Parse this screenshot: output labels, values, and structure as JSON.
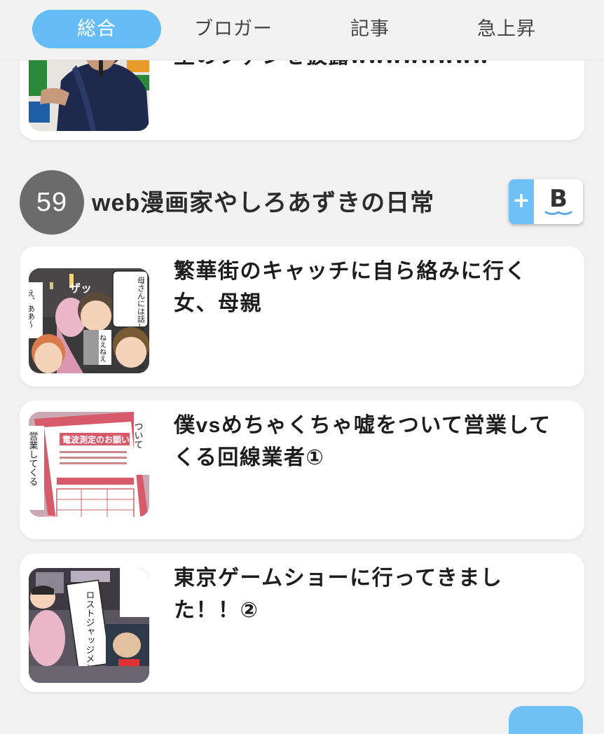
{
  "tabs": [
    {
      "label": "総合",
      "active": true
    },
    {
      "label": "ブロガー",
      "active": false
    },
    {
      "label": "記事",
      "active": false
    },
    {
      "label": "急上昇",
      "active": false
    }
  ],
  "top_card": {
    "title": "里のファンを披露wwwwwwww",
    "thumb_icon": "baseball-player-photo"
  },
  "blog": {
    "rank": "59",
    "name": "web漫画家やしろあずきの日常",
    "hatena_plus": "+",
    "hatena_b": "B",
    "accent_color": "#66bdf6"
  },
  "articles": [
    {
      "title": "繁華街のキャッチに自ら絡みに行く女、母親",
      "thumb_icon": "manga-thumbnail"
    },
    {
      "title": "僕vsめちゃくちゃ嘘をついて営業してくる回線業者①",
      "thumb_icon": "manga-thumbnail"
    },
    {
      "title": "東京ゲームショーに行ってきました！！②",
      "thumb_icon": "manga-thumbnail"
    }
  ],
  "thumb_text": {
    "a1_bubble": "母さんには話しかけてこないね!!",
    "a1_side": "え、ああ〜",
    "a1_bottom": "ねえねえ",
    "a1_sfx": "ザッ",
    "a2_paper": "電波測定のお願い",
    "a2_side": "営業してくる",
    "a2_right": "ついて",
    "a3_bubble": "ロストジャッジメント"
  }
}
